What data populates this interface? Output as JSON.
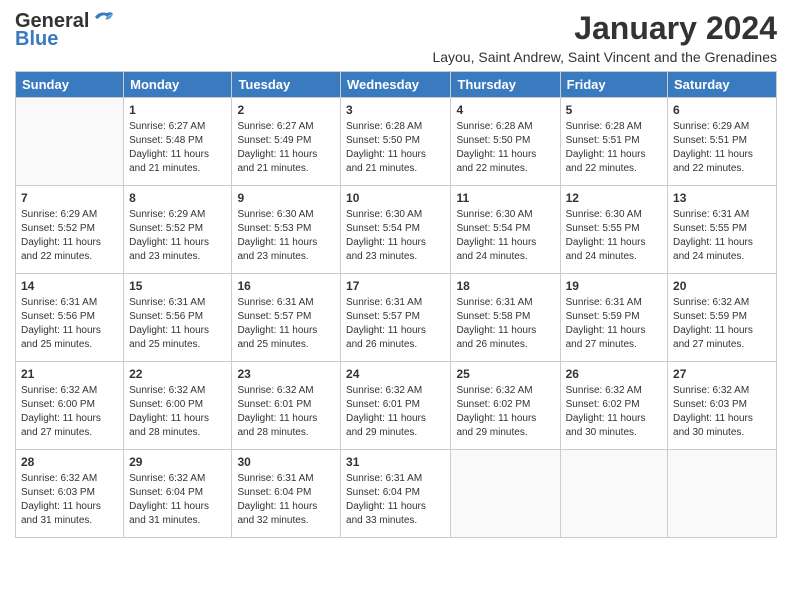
{
  "header": {
    "logo_line1": "General",
    "logo_line2": "Blue",
    "month_title": "January 2024",
    "location": "Layou, Saint Andrew, Saint Vincent and the Grenadines"
  },
  "weekdays": [
    "Sunday",
    "Monday",
    "Tuesday",
    "Wednesday",
    "Thursday",
    "Friday",
    "Saturday"
  ],
  "weeks": [
    [
      {
        "day": "",
        "info": ""
      },
      {
        "day": "1",
        "info": "Sunrise: 6:27 AM\nSunset: 5:48 PM\nDaylight: 11 hours\nand 21 minutes."
      },
      {
        "day": "2",
        "info": "Sunrise: 6:27 AM\nSunset: 5:49 PM\nDaylight: 11 hours\nand 21 minutes."
      },
      {
        "day": "3",
        "info": "Sunrise: 6:28 AM\nSunset: 5:50 PM\nDaylight: 11 hours\nand 21 minutes."
      },
      {
        "day": "4",
        "info": "Sunrise: 6:28 AM\nSunset: 5:50 PM\nDaylight: 11 hours\nand 22 minutes."
      },
      {
        "day": "5",
        "info": "Sunrise: 6:28 AM\nSunset: 5:51 PM\nDaylight: 11 hours\nand 22 minutes."
      },
      {
        "day": "6",
        "info": "Sunrise: 6:29 AM\nSunset: 5:51 PM\nDaylight: 11 hours\nand 22 minutes."
      }
    ],
    [
      {
        "day": "7",
        "info": "Sunrise: 6:29 AM\nSunset: 5:52 PM\nDaylight: 11 hours\nand 22 minutes."
      },
      {
        "day": "8",
        "info": "Sunrise: 6:29 AM\nSunset: 5:52 PM\nDaylight: 11 hours\nand 23 minutes."
      },
      {
        "day": "9",
        "info": "Sunrise: 6:30 AM\nSunset: 5:53 PM\nDaylight: 11 hours\nand 23 minutes."
      },
      {
        "day": "10",
        "info": "Sunrise: 6:30 AM\nSunset: 5:54 PM\nDaylight: 11 hours\nand 23 minutes."
      },
      {
        "day": "11",
        "info": "Sunrise: 6:30 AM\nSunset: 5:54 PM\nDaylight: 11 hours\nand 24 minutes."
      },
      {
        "day": "12",
        "info": "Sunrise: 6:30 AM\nSunset: 5:55 PM\nDaylight: 11 hours\nand 24 minutes."
      },
      {
        "day": "13",
        "info": "Sunrise: 6:31 AM\nSunset: 5:55 PM\nDaylight: 11 hours\nand 24 minutes."
      }
    ],
    [
      {
        "day": "14",
        "info": "Sunrise: 6:31 AM\nSunset: 5:56 PM\nDaylight: 11 hours\nand 25 minutes."
      },
      {
        "day": "15",
        "info": "Sunrise: 6:31 AM\nSunset: 5:56 PM\nDaylight: 11 hours\nand 25 minutes."
      },
      {
        "day": "16",
        "info": "Sunrise: 6:31 AM\nSunset: 5:57 PM\nDaylight: 11 hours\nand 25 minutes."
      },
      {
        "day": "17",
        "info": "Sunrise: 6:31 AM\nSunset: 5:57 PM\nDaylight: 11 hours\nand 26 minutes."
      },
      {
        "day": "18",
        "info": "Sunrise: 6:31 AM\nSunset: 5:58 PM\nDaylight: 11 hours\nand 26 minutes."
      },
      {
        "day": "19",
        "info": "Sunrise: 6:31 AM\nSunset: 5:59 PM\nDaylight: 11 hours\nand 27 minutes."
      },
      {
        "day": "20",
        "info": "Sunrise: 6:32 AM\nSunset: 5:59 PM\nDaylight: 11 hours\nand 27 minutes."
      }
    ],
    [
      {
        "day": "21",
        "info": "Sunrise: 6:32 AM\nSunset: 6:00 PM\nDaylight: 11 hours\nand 27 minutes."
      },
      {
        "day": "22",
        "info": "Sunrise: 6:32 AM\nSunset: 6:00 PM\nDaylight: 11 hours\nand 28 minutes."
      },
      {
        "day": "23",
        "info": "Sunrise: 6:32 AM\nSunset: 6:01 PM\nDaylight: 11 hours\nand 28 minutes."
      },
      {
        "day": "24",
        "info": "Sunrise: 6:32 AM\nSunset: 6:01 PM\nDaylight: 11 hours\nand 29 minutes."
      },
      {
        "day": "25",
        "info": "Sunrise: 6:32 AM\nSunset: 6:02 PM\nDaylight: 11 hours\nand 29 minutes."
      },
      {
        "day": "26",
        "info": "Sunrise: 6:32 AM\nSunset: 6:02 PM\nDaylight: 11 hours\nand 30 minutes."
      },
      {
        "day": "27",
        "info": "Sunrise: 6:32 AM\nSunset: 6:03 PM\nDaylight: 11 hours\nand 30 minutes."
      }
    ],
    [
      {
        "day": "28",
        "info": "Sunrise: 6:32 AM\nSunset: 6:03 PM\nDaylight: 11 hours\nand 31 minutes."
      },
      {
        "day": "29",
        "info": "Sunrise: 6:32 AM\nSunset: 6:04 PM\nDaylight: 11 hours\nand 31 minutes."
      },
      {
        "day": "30",
        "info": "Sunrise: 6:31 AM\nSunset: 6:04 PM\nDaylight: 11 hours\nand 32 minutes."
      },
      {
        "day": "31",
        "info": "Sunrise: 6:31 AM\nSunset: 6:04 PM\nDaylight: 11 hours\nand 33 minutes."
      },
      {
        "day": "",
        "info": ""
      },
      {
        "day": "",
        "info": ""
      },
      {
        "day": "",
        "info": ""
      }
    ]
  ]
}
